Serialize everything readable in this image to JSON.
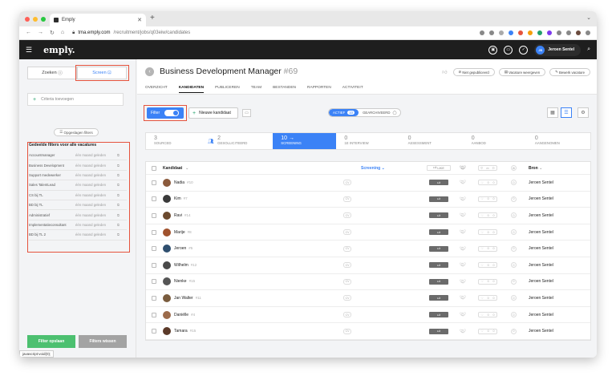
{
  "browser": {
    "tab_title": "Emply",
    "url_host": "tma.emply.com",
    "url_path": "/recruitment/jobs/q03eiw/candidates",
    "status_bar": "javascript:void(0);"
  },
  "app": {
    "logo": "emply.",
    "user_initials": "JS",
    "user_name": "Jeroen Sentel"
  },
  "sidebar": {
    "tab_search": "Zoeken",
    "tab_screen": "Screen",
    "criteria_placeholder": "Criteria toevoegen",
    "saved_filters_button": "Opgeslagen filters",
    "shared_filters_title": "Gedeelde filters voor alle vacatures",
    "filters": [
      {
        "name": "Accountmanager",
        "meta": "één maand geleden"
      },
      {
        "name": "Business Development",
        "meta": "één maand geleden"
      },
      {
        "name": "Support medewerker",
        "meta": "één maand geleden"
      },
      {
        "name": "Sales TalentLead",
        "meta": "één maand geleden"
      },
      {
        "name": "CS bij TL",
        "meta": "één maand geleden"
      },
      {
        "name": "BD bij TL",
        "meta": "één maand geleden"
      },
      {
        "name": "Administratief",
        "meta": "één maand geleden"
      },
      {
        "name": "Implementatieconsultant",
        "meta": "één maand geleden"
      },
      {
        "name": "BD bij TL 2",
        "meta": "één maand geleden"
      }
    ],
    "save_button": "Filter opslaan",
    "clear_button": "Filters wissen"
  },
  "job": {
    "title": "Business Development Manager",
    "number": "#69",
    "btn_unpublished": "Niet gepubliceerd",
    "btn_view": "Vacature weergeven",
    "btn_edit": "Bewerk vacature",
    "tabs": [
      "OVERZICHT",
      "KANDIDATEN",
      "PUBLICEREN",
      "TEAM",
      "BESTANDEN",
      "RAPPORTEN",
      "ACTIVITEIT"
    ]
  },
  "toolbar": {
    "filter_label": "Filter",
    "new_candidate": "Nieuwe kandidaat",
    "status_active": "ACTIEF",
    "status_active_count": "10",
    "status_archived": "GEARCHIVEERD"
  },
  "pipeline": [
    {
      "count": "3",
      "label": "SOURCED"
    },
    {
      "count": "2",
      "label": "GESOLLICITEERD"
    },
    {
      "count": "10 →",
      "label": "SCREENING"
    },
    {
      "count": "0",
      "label": "1E INTERVIEW"
    },
    {
      "count": "0",
      "label": "ASSESSMENT"
    },
    {
      "count": "0",
      "label": "AANBOD"
    },
    {
      "count": "0",
      "label": "AANGENOMEN"
    }
  ],
  "table": {
    "col_candidate": "Kandidaat",
    "col_stage": "Screening",
    "col_like": "LIKE",
    "col_source": "Bron",
    "rows": [
      {
        "name": "Nadia",
        "num": "#10",
        "source": "Jeroen Sentel"
      },
      {
        "name": "Kim",
        "num": "#7",
        "source": "Jeroen Sentel"
      },
      {
        "name": "Ravi",
        "num": "#14",
        "source": "Jeroen Sentel"
      },
      {
        "name": "Marije",
        "num": "#8",
        "source": "Jeroen Sentel"
      },
      {
        "name": "Jeroen",
        "num": "#5",
        "source": "Jeroen Sentel"
      },
      {
        "name": "Wilhelm",
        "num": "#12",
        "source": "Jeroen Sentel"
      },
      {
        "name": "Nienke",
        "num": "#15",
        "source": "Jeroen Sentel"
      },
      {
        "name": "Jan Walter",
        "num": "#11",
        "source": "Jeroen Sentel"
      },
      {
        "name": "Daniëlle",
        "num": "#4",
        "source": "Jeroen Sentel"
      },
      {
        "name": "Tamara",
        "num": "#15",
        "source": "Jeroen Sentel"
      }
    ]
  },
  "colors": {
    "accent": "#3b82f6",
    "green": "#22a06b",
    "highlight": "#e5533d"
  }
}
